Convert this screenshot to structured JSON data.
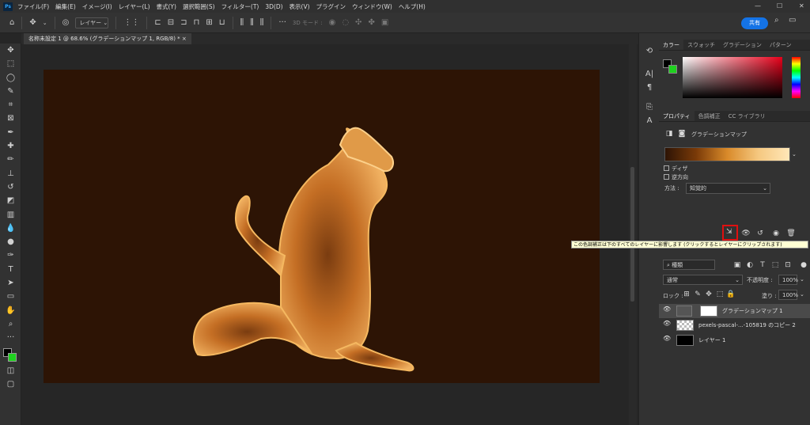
{
  "menubar": {
    "logo": "Ps",
    "items": [
      "ファイル(F)",
      "編集(E)",
      "イメージ(I)",
      "レイヤー(L)",
      "書式(Y)",
      "選択範囲(S)",
      "フィルター(T)",
      "3D(D)",
      "表示(V)",
      "プラグイン",
      "ウィンドウ(W)",
      "ヘルプ(H)"
    ],
    "minimize": "—",
    "maximize": "☐",
    "close": "✕"
  },
  "options": {
    "layer_select": "レイヤー",
    "mode_3d": "3D モード :",
    "share": "共有"
  },
  "document": {
    "tab_title": "名称未設定 1 @ 68.6% (グラデーションマップ 1, RGB/8) *"
  },
  "color_panel": {
    "tabs": [
      "カラー",
      "スウォッチ",
      "グラデーション",
      "パターン"
    ],
    "foreground": "#000000",
    "background": "#1fd21f"
  },
  "properties": {
    "tabs": [
      "プロパティ",
      "色調補正",
      "CC ライブラリ"
    ],
    "title": "グラデーションマップ",
    "dither": "ディザ",
    "reverse": "逆方向",
    "method_label": "方法 :",
    "method_value": "知覚的"
  },
  "tooltip": "この色調補正は下のすべてのレイヤーに影響します (クリックするとレイヤーにクリップされます)",
  "layers": {
    "filter_label": "種類",
    "blend_mode": "通常",
    "opacity_label": "不透明度 :",
    "opacity_value": "100%",
    "lock_label": "ロック :",
    "fill_label": "塗り :",
    "fill_value": "100%",
    "items": [
      {
        "name": "グラデーションマップ 1"
      },
      {
        "name": "pexels-pascal-...-105819 のコピー 2"
      },
      {
        "name": "レイヤー 1"
      }
    ]
  },
  "accent": "#1473e6"
}
